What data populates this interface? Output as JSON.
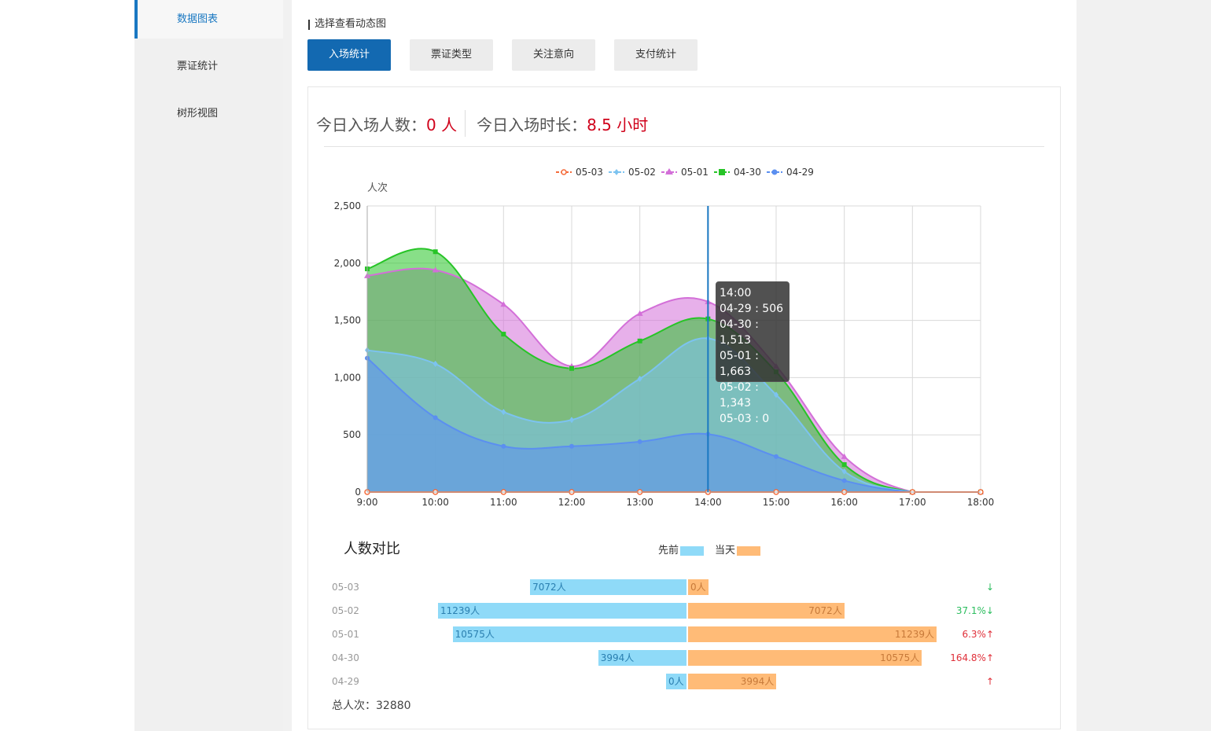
{
  "sidebar": {
    "items": [
      {
        "label": "数据图表",
        "active": true
      },
      {
        "label": "票证统计",
        "active": false
      },
      {
        "label": "树形视图",
        "active": false
      }
    ]
  },
  "main": {
    "select_label": "选择查看动态图",
    "tabs": [
      {
        "label": "入场统计",
        "active": true
      },
      {
        "label": "票证类型",
        "active": false
      },
      {
        "label": "关注意向",
        "active": false
      },
      {
        "label": "支付统计",
        "active": false
      }
    ],
    "stats": {
      "today_count_label": "今日入场人数：",
      "today_count_value": "0 人",
      "today_duration_label": "今日入场时长：",
      "today_duration_value": "8.5 小时"
    }
  },
  "chart_data": {
    "type": "area",
    "ylabel": "人次",
    "ylim": [
      0,
      2500
    ],
    "yticks": [
      "0",
      "500",
      "1,000",
      "1,500",
      "2,000",
      "2,500"
    ],
    "categories": [
      "9:00",
      "10:00",
      "11:00",
      "12:00",
      "13:00",
      "14:00",
      "15:00",
      "16:00",
      "17:00",
      "18:00"
    ],
    "grid": true,
    "legend_position": "top",
    "series": [
      {
        "name": "05-03",
        "color": "#f56b3a",
        "marker": "circle-open",
        "values": [
          0,
          0,
          0,
          0,
          0,
          0,
          0,
          0,
          0,
          0
        ]
      },
      {
        "name": "05-02",
        "color": "#7cc3f0",
        "marker": "diamond",
        "values": [
          1240,
          1120,
          700,
          630,
          990,
          1343,
          850,
          180,
          0,
          0
        ]
      },
      {
        "name": "05-01",
        "color": "#d36fd8",
        "marker": "triangle",
        "values": [
          1890,
          1940,
          1640,
          1100,
          1560,
          1663,
          1100,
          310,
          0,
          0
        ]
      },
      {
        "name": "04-30",
        "color": "#27c427",
        "marker": "square",
        "values": [
          1950,
          2100,
          1380,
          1080,
          1320,
          1513,
          1050,
          240,
          0,
          0
        ]
      },
      {
        "name": "04-29",
        "color": "#5b8ff0",
        "marker": "circle",
        "values": [
          1170,
          650,
          400,
          400,
          440,
          506,
          310,
          100,
          0,
          0
        ]
      }
    ],
    "tooltip": {
      "title": "14:00",
      "lines": [
        "04-29 : 506",
        "04-30 : 1,513",
        "05-01 : 1,663",
        "05-02 : 1,343",
        "05-03 : 0"
      ]
    }
  },
  "compare": {
    "title": "人数对比",
    "legend_before": "先前",
    "legend_today": "当天",
    "color_before": "#8fdaf8",
    "color_today": "#ffbb77",
    "rows": [
      {
        "date": "05-03",
        "before": 7072,
        "before_label": "7072人",
        "today": 0,
        "today_label": "0人",
        "change": "↓",
        "trend": "down"
      },
      {
        "date": "05-02",
        "before": 11239,
        "before_label": "11239人",
        "today": 7072,
        "today_label": "7072人",
        "change": "37.1%↓",
        "trend": "down"
      },
      {
        "date": "05-01",
        "before": 10575,
        "before_label": "10575人",
        "today": 11239,
        "today_label": "11239人",
        "change": "6.3%↑",
        "trend": "up"
      },
      {
        "date": "04-30",
        "before": 3994,
        "before_label": "3994人",
        "today": 10575,
        "today_label": "10575人",
        "change": "164.8%↑",
        "trend": "up"
      },
      {
        "date": "04-29",
        "before": 0,
        "before_label": "0人",
        "today": 3994,
        "today_label": "3994人",
        "change": "↑",
        "trend": "up"
      }
    ],
    "total": "总人次：32880"
  }
}
